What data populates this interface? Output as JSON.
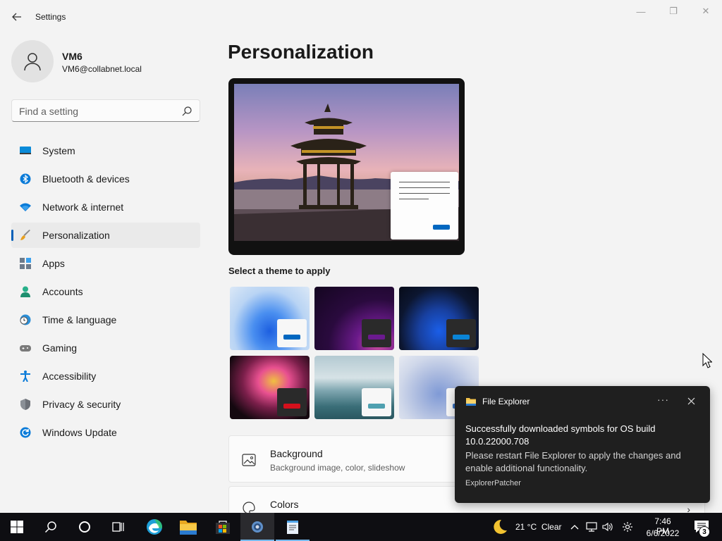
{
  "window": {
    "title": "Settings",
    "controls": {
      "minimize": "—",
      "maximize": "❐",
      "close": "✕"
    }
  },
  "profile": {
    "name": "VM6",
    "email": "VM6@collabnet.local"
  },
  "search": {
    "placeholder": "Find a setting",
    "value": ""
  },
  "sidebar": {
    "items": [
      {
        "label": "System",
        "icon": "monitor-icon"
      },
      {
        "label": "Bluetooth & devices",
        "icon": "bluetooth-icon"
      },
      {
        "label": "Network & internet",
        "icon": "wifi-icon"
      },
      {
        "label": "Personalization",
        "icon": "brush-icon",
        "active": true
      },
      {
        "label": "Apps",
        "icon": "apps-icon"
      },
      {
        "label": "Accounts",
        "icon": "person-icon"
      },
      {
        "label": "Time & language",
        "icon": "clock-globe-icon"
      },
      {
        "label": "Gaming",
        "icon": "gamepad-icon"
      },
      {
        "label": "Accessibility",
        "icon": "accessibility-icon"
      },
      {
        "label": "Privacy & security",
        "icon": "shield-icon"
      },
      {
        "label": "Windows Update",
        "icon": "update-icon"
      }
    ]
  },
  "main": {
    "title": "Personalization",
    "themes_label": "Select a theme to apply",
    "themes": [
      {
        "name": "windows-light",
        "accent": "#0067c0"
      },
      {
        "name": "windows-dark-glow",
        "accent": "#6b1a8f"
      },
      {
        "name": "windows-dark",
        "accent": "#0a84d6"
      },
      {
        "name": "captured-motion",
        "accent": "#d4101c"
      },
      {
        "name": "sunrise",
        "accent": "#4fa0b0"
      },
      {
        "name": "flow",
        "accent": "#3a74c4"
      }
    ],
    "cards": [
      {
        "title": "Background",
        "subtitle": "Background image, color, slideshow"
      },
      {
        "title": "Colors",
        "subtitle": ""
      }
    ]
  },
  "toast": {
    "app": "File Explorer",
    "more": "···",
    "title": "Successfully downloaded symbols for OS build 10.0.22000.708",
    "body": "Please restart File Explorer to apply the changes and enable additional functionality.",
    "attribution": "ExplorerPatcher"
  },
  "taskbar": {
    "weather": {
      "temp": "21 °C",
      "condition": "Clear"
    },
    "clock": {
      "time": "7:46 PM",
      "date": "6/6/2022"
    },
    "notifications": "3"
  },
  "colors": {
    "accent": "#005fb8",
    "toast_bg": "#1f1f1f",
    "taskbar_bg": "#0e0e12"
  }
}
